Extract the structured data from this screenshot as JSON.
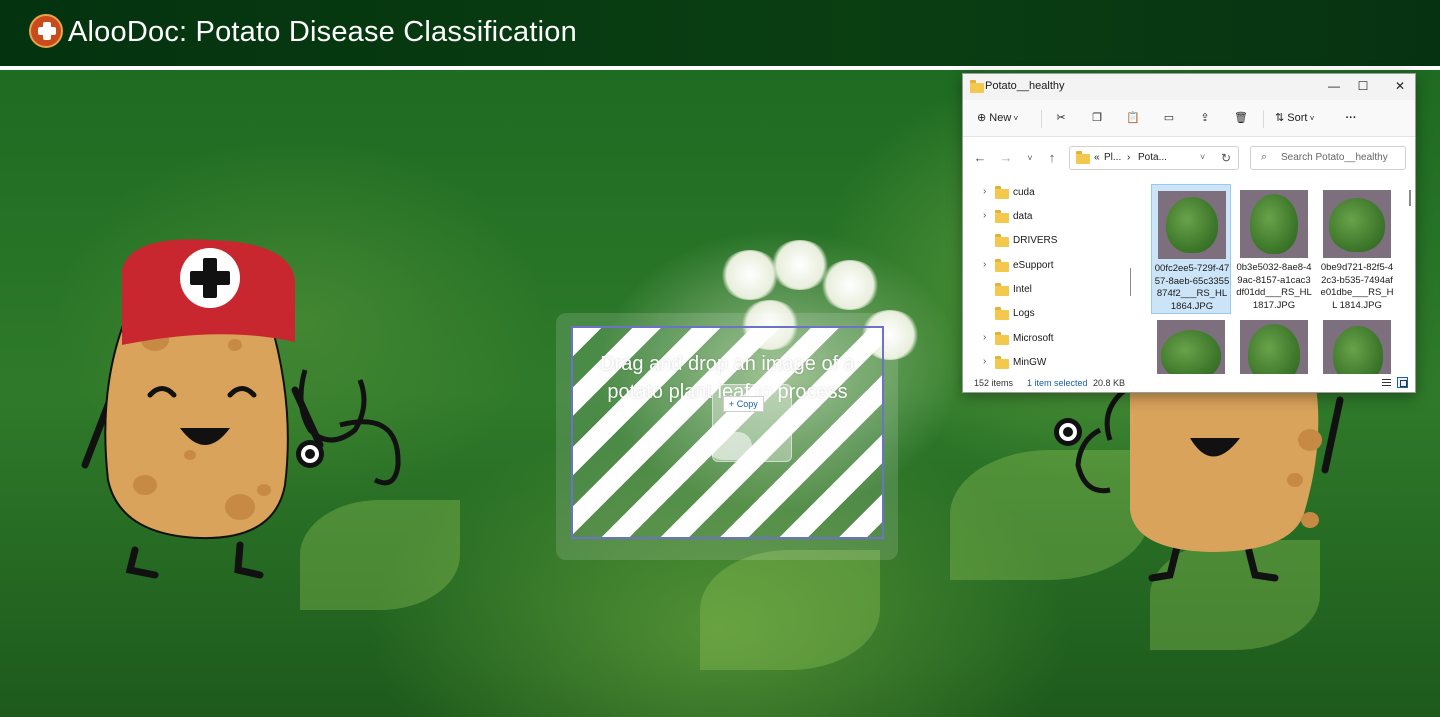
{
  "app": {
    "title": "AlooDoc: Potato Disease Classification"
  },
  "dropzone": {
    "text": "Drag and drop an image of a potato plant leaf to process",
    "drag_label": "Copy"
  },
  "explorer": {
    "window_title": "Potato__healthy",
    "toolbar": {
      "new_label": "New",
      "sort_label": "Sort",
      "more_label": "···"
    },
    "address": {
      "prefix": "«",
      "part1": "Pl...",
      "separator": "›",
      "part2": "Pota..."
    },
    "search_placeholder": "Search Potato__healthy",
    "tree": [
      {
        "label": "cuda",
        "expandable": true
      },
      {
        "label": "data",
        "expandable": true
      },
      {
        "label": "DRIVERS",
        "expandable": false
      },
      {
        "label": "eSupport",
        "expandable": true
      },
      {
        "label": "Intel",
        "expandable": false
      },
      {
        "label": "Logs",
        "expandable": false
      },
      {
        "label": "Microsoft",
        "expandable": true
      },
      {
        "label": "MinGW",
        "expandable": true
      }
    ],
    "files": [
      {
        "name": "00fc2ee5-729f-4757-8aeb-65c3355874f2___RS_HL 1864.JPG",
        "selected": true
      },
      {
        "name": "0b3e5032-8ae8-49ac-8157-a1cac3df01dd___RS_HL 1817.JPG",
        "selected": false
      },
      {
        "name": "0be9d721-82f5-42c3-b535-7494afe01dbe___RS_HL 1814.JPG",
        "selected": false
      },
      {
        "name": "",
        "selected": false
      },
      {
        "name": "",
        "selected": false
      },
      {
        "name": "",
        "selected": false
      }
    ],
    "status": {
      "count": "152 items",
      "selection": "1 item selected",
      "size": "20.8 KB"
    }
  },
  "colors": {
    "header_bg": "#04330f",
    "dropzone_border": "#6b72c7",
    "selection": "#cce4f7",
    "potato_body": "#d9a35b",
    "cap_red": "#c8272f"
  }
}
